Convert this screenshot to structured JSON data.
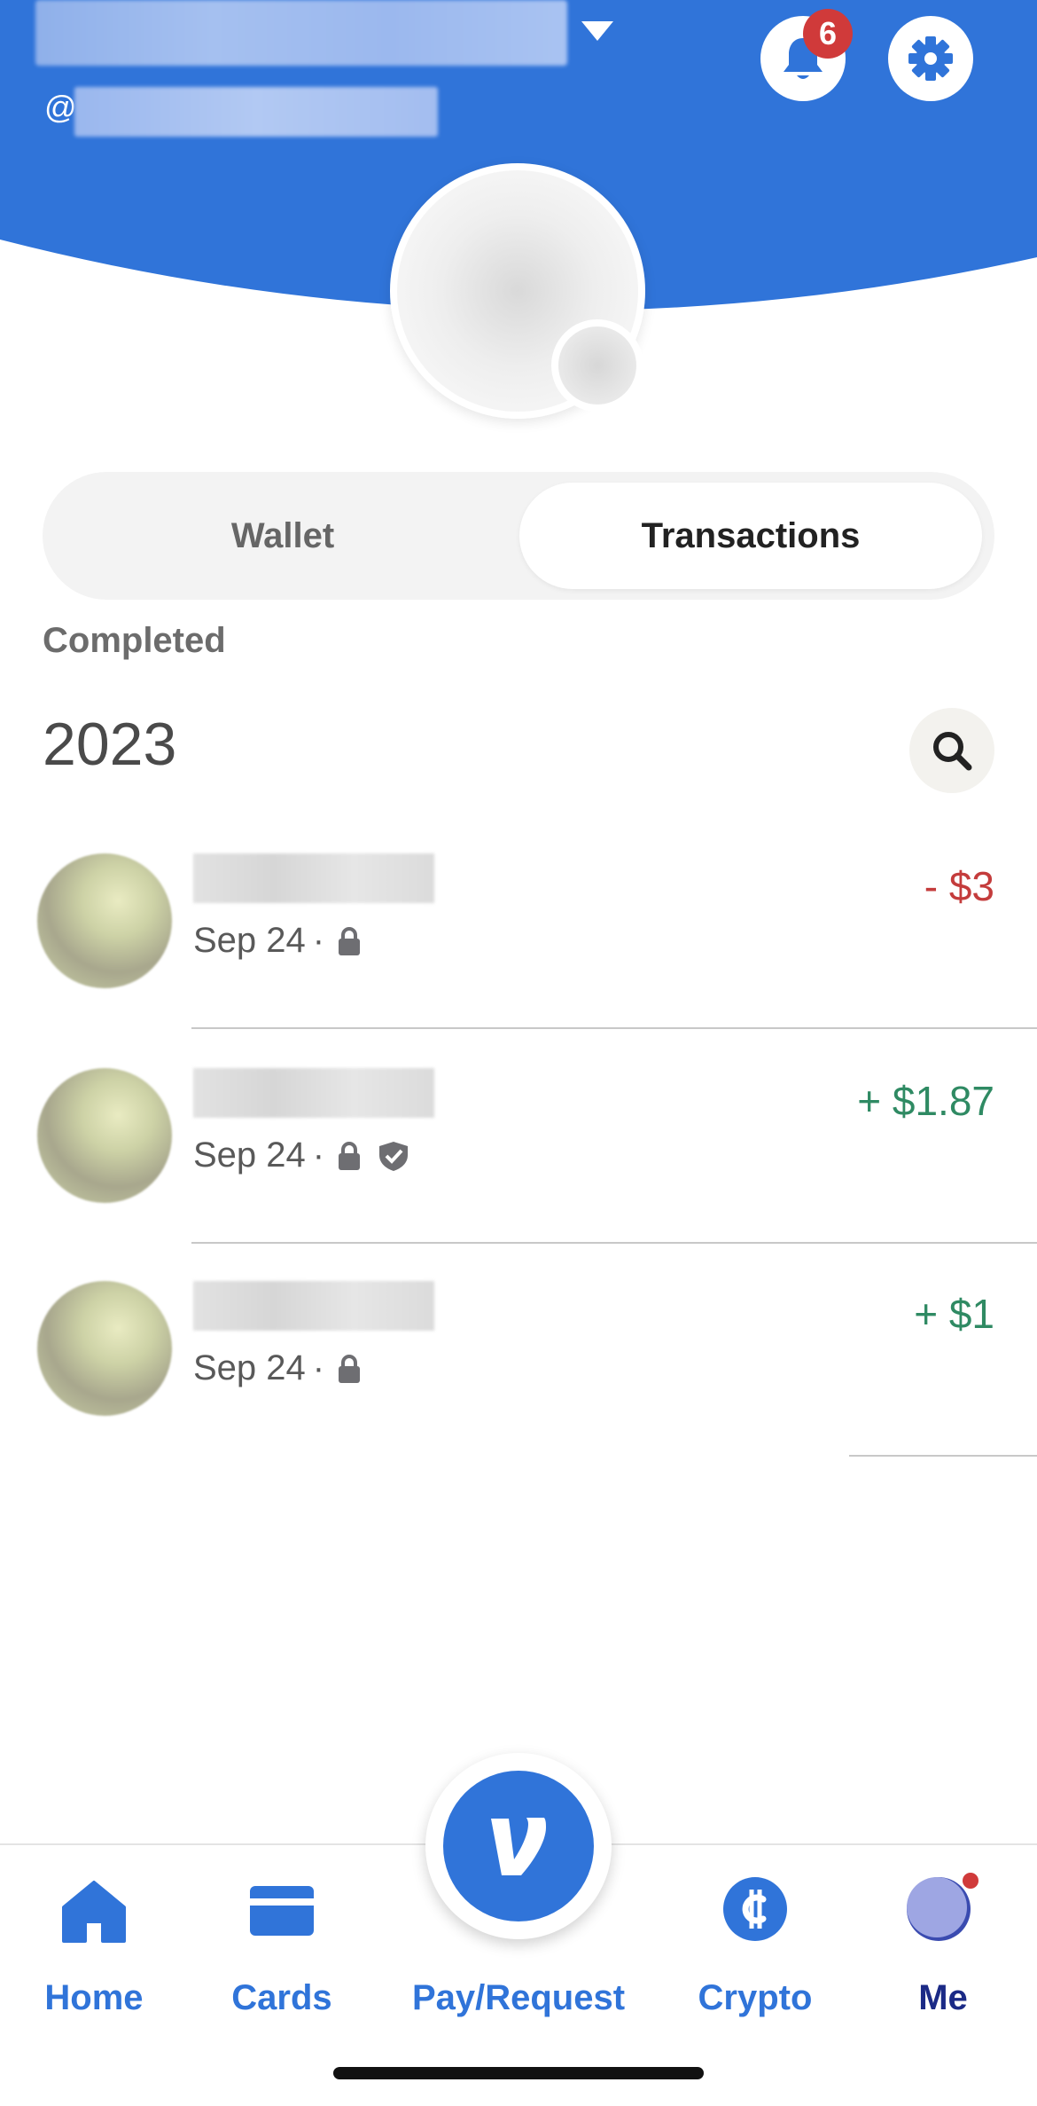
{
  "colors": {
    "brand_blue": "#3074d9",
    "negative": "#c43c3c",
    "positive": "#2f8a63",
    "badge": "#d03a3a"
  },
  "header": {
    "handle_prefix": "@",
    "notification_count": "6",
    "icons": {
      "notifications": "bell-icon",
      "settings": "gear-icon",
      "account_menu": "caret-down-icon"
    }
  },
  "tabs": [
    {
      "label": "Wallet",
      "selected": false
    },
    {
      "label": "Transactions",
      "selected": true
    }
  ],
  "section_label": "Completed",
  "year": "2023",
  "transactions": [
    {
      "date": "Sep 24",
      "separator": "·",
      "amount": "- $3",
      "direction": "debit",
      "icons": [
        "lock-icon"
      ]
    },
    {
      "date": "Sep 24",
      "separator": "·",
      "amount": "+ $1.87",
      "direction": "credit",
      "icons": [
        "lock-icon",
        "shield-check-icon"
      ]
    },
    {
      "date": "Sep 24",
      "separator": "·",
      "amount": "+ $1",
      "direction": "credit",
      "icons": [
        "lock-icon"
      ]
    }
  ],
  "bottom_nav": [
    {
      "label": "Home",
      "icon": "home-icon",
      "active": false
    },
    {
      "label": "Cards",
      "icon": "card-icon",
      "active": false
    },
    {
      "label": "Pay/Request",
      "icon": "venmo-v-icon",
      "active": false
    },
    {
      "label": "Crypto",
      "icon": "crypto-icon",
      "active": false
    },
    {
      "label": "Me",
      "icon": "avatar-icon",
      "active": true
    }
  ]
}
